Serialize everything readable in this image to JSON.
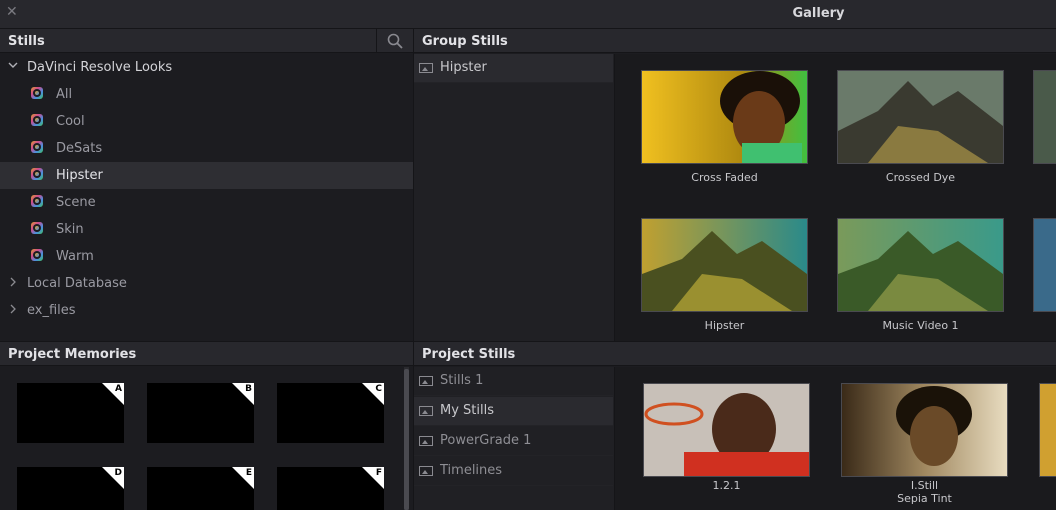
{
  "window": {
    "title": "Gallery",
    "close_glyph": "✕"
  },
  "stills_panel": {
    "header": "Stills",
    "search_icon": "search-icon",
    "tree": [
      {
        "label": "DaVinci Resolve Looks",
        "expanded": true
      },
      {
        "label": "All"
      },
      {
        "label": "Cool"
      },
      {
        "label": "DeSats"
      },
      {
        "label": "Hipster",
        "selected": true
      },
      {
        "label": "Scene"
      },
      {
        "label": "Skin"
      },
      {
        "label": "Warm"
      },
      {
        "label": "Local Database",
        "expanded": false
      },
      {
        "label": "ex_files",
        "expanded": false
      }
    ]
  },
  "group_stills": {
    "header": "Group Stills",
    "albums": [
      {
        "label": "Hipster",
        "selected": true
      }
    ],
    "stills": [
      {
        "caption": "Cross Faded"
      },
      {
        "caption": "Crossed Dye"
      },
      {
        "caption": "Hipster"
      },
      {
        "caption": "Music Video 1"
      }
    ]
  },
  "project_memories": {
    "header": "Project Memories",
    "slots": [
      "A",
      "B",
      "C",
      "D",
      "E",
      "F"
    ]
  },
  "project_stills": {
    "header": "Project Stills",
    "albums": [
      {
        "label": "Stills 1"
      },
      {
        "label": "My Stills",
        "selected": true
      },
      {
        "label": "PowerGrade 1"
      },
      {
        "label": "Timelines"
      }
    ],
    "stills": [
      {
        "caption": "1.2.1",
        "subcaption": ""
      },
      {
        "caption": "I.Still",
        "subcaption": "Sepia Tint"
      }
    ]
  },
  "colors": {
    "accent": "#e4e4e8",
    "panel": "#28282d",
    "background": "#1c1c20"
  }
}
